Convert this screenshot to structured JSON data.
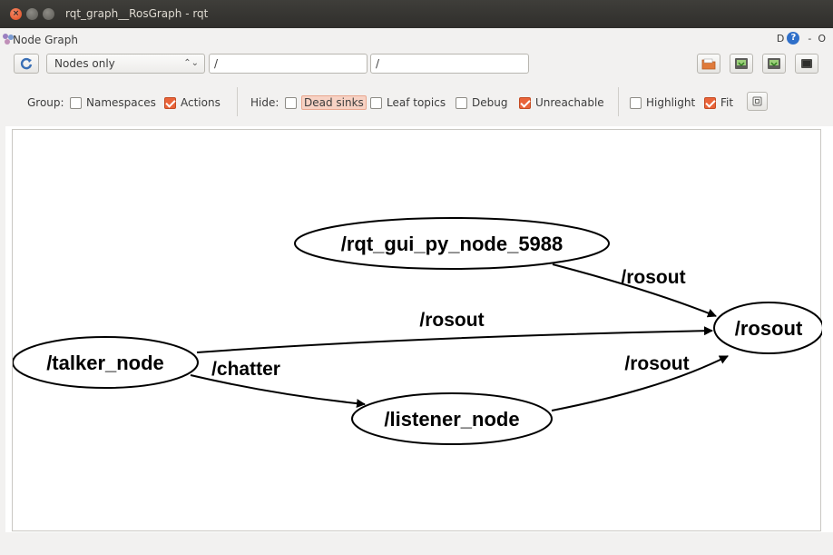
{
  "window": {
    "title": "rqt_graph__RosGraph - rqt"
  },
  "plugin": {
    "title": "Node Graph",
    "right_label": "D",
    "help": "?",
    "minimize": "-",
    "close": "O"
  },
  "toolbar": {
    "mode_select": "Nodes only",
    "mode_arrow": "⌃⌄",
    "node_filter": "/",
    "topic_filter": "/"
  },
  "options": {
    "group_label": "Group:",
    "namespaces": {
      "label": "Namespaces",
      "checked": false
    },
    "actions": {
      "label": "Actions",
      "checked": true
    },
    "hide_label": "Hide:",
    "dead_sinks": {
      "label": "Dead sinks",
      "checked": false
    },
    "leaf_topics": {
      "label": "Leaf topics",
      "checked": false
    },
    "debug": {
      "label": "Debug",
      "checked": false
    },
    "unreachable": {
      "label": "Unreachable",
      "checked": true
    },
    "highlight": {
      "label": "Highlight",
      "checked": false
    },
    "fit": {
      "label": "Fit",
      "checked": true
    }
  },
  "graph": {
    "nodes": {
      "rqt_gui": "/rqt_gui_py_node_5988",
      "talker": "/talker_node",
      "listener": "/listener_node",
      "rosout": "/rosout"
    },
    "edges": {
      "rqt_to_rosout": "/rosout",
      "talker_to_rosout": "/rosout",
      "talker_to_listener": "/chatter",
      "listener_to_rosout": "/rosout"
    }
  }
}
